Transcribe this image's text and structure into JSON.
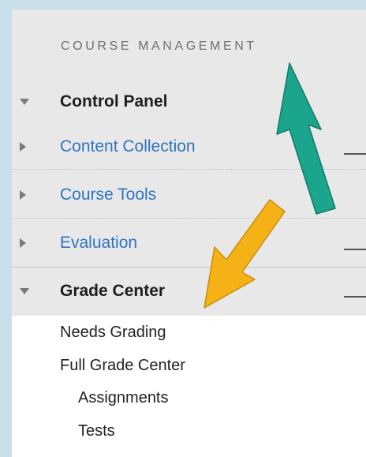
{
  "section": {
    "header": "COURSE MANAGEMENT"
  },
  "menu": {
    "control_panel": "Control Panel",
    "content_collection": "Content Collection",
    "course_tools": "Course Tools",
    "evaluation": "Evaluation",
    "grade_center": "Grade Center"
  },
  "grade_center_items": {
    "needs_grading": "Needs Grading",
    "full_grade_center": "Full Grade Center",
    "assignments": "Assignments",
    "tests": "Tests"
  },
  "icons": {
    "expanded": "triangle-down-icon",
    "collapsed": "triangle-right-icon",
    "annotation_1": "green-arrow-icon",
    "annotation_2": "orange-arrow-icon"
  },
  "colors": {
    "page_background": "#c9dfe9",
    "panel_gray": "#e8e8e8",
    "link_blue": "#2f74c0",
    "green_arrow": "#1aa58c",
    "orange_arrow": "#f5b217"
  }
}
